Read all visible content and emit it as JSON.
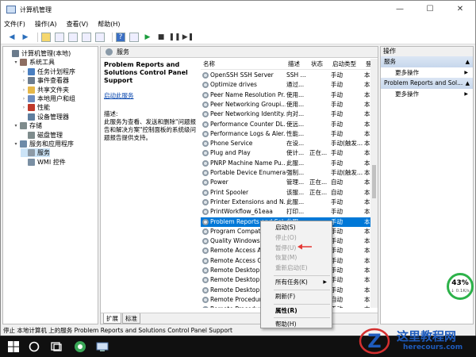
{
  "window": {
    "title": "计算机管理",
    "minimize": "—",
    "maximize": "☐",
    "close": "✕"
  },
  "menu": [
    "文件(F)",
    "操作(A)",
    "查看(V)",
    "帮助(H)"
  ],
  "tree": [
    {
      "label": "计算机管理(本地)",
      "level": 0,
      "exp": "",
      "color": "#6b7b8c"
    },
    {
      "label": "系统工具",
      "level": 1,
      "exp": "▾",
      "color": "#8d6e63"
    },
    {
      "label": "任务计划程序",
      "level": 2,
      "exp": "›",
      "color": "#4a7fc1"
    },
    {
      "label": "事件查看器",
      "level": 2,
      "exp": "›",
      "color": "#6d7d8f"
    },
    {
      "label": "共享文件夹",
      "level": 2,
      "exp": "›",
      "color": "#e6b84a"
    },
    {
      "label": "本地用户和组",
      "level": 2,
      "exp": "›",
      "color": "#6c8cc0"
    },
    {
      "label": "性能",
      "level": 2,
      "exp": "›",
      "color": "#c0392b"
    },
    {
      "label": "设备管理器",
      "level": 2,
      "exp": "",
      "color": "#5f7f9f"
    },
    {
      "label": "存储",
      "level": 1,
      "exp": "▾",
      "color": "#7f8c8d"
    },
    {
      "label": "磁盘管理",
      "level": 2,
      "exp": "",
      "color": "#7f8c8d"
    },
    {
      "label": "服务和应用程序",
      "level": 1,
      "exp": "▾",
      "color": "#6d8aa8"
    },
    {
      "label": "服务",
      "level": 2,
      "exp": "",
      "color": "#8d9aa6",
      "selected": true
    },
    {
      "label": "WMI 控件",
      "level": 2,
      "exp": "",
      "color": "#7a8fa3"
    }
  ],
  "services_header": "服务",
  "description": {
    "name": "Problem Reports and Solutions Control Panel Support",
    "link": "启动此服务",
    "label": "描述:",
    "text": "此服务为查看、发送和删除\"问题报告和解决方案\"控制面板的系统级问题报告提供支持。"
  },
  "columns": [
    "名称",
    "描述",
    "状态",
    "启动类型",
    "登"
  ],
  "rows": [
    [
      "OpenSSH SSH Server",
      "SSH ...",
      "",
      "手动",
      "本"
    ],
    [
      "Optimize drives",
      "通过...",
      "",
      "手动",
      "本"
    ],
    [
      "Peer Name Resolution Pr...",
      "使用...",
      "",
      "手动",
      "本"
    ],
    [
      "Peer Networking Groupi...",
      "使用...",
      "",
      "手动",
      "本"
    ],
    [
      "Peer Networking Identity...",
      "向对...",
      "",
      "手动",
      "本"
    ],
    [
      "Performance Counter DL...",
      "使远...",
      "",
      "手动",
      "本"
    ],
    [
      "Performance Logs & Aler...",
      "性能...",
      "",
      "手动",
      "本"
    ],
    [
      "Phone Service",
      "在设...",
      "",
      "手动(触发...",
      "本"
    ],
    [
      "Plug and Play",
      "使计...",
      "正在...",
      "手动",
      "本"
    ],
    [
      "PNRP Machine Name Pu...",
      "此服...",
      "",
      "手动",
      "本"
    ],
    [
      "Portable Device Enumera...",
      "强制...",
      "",
      "手动(触发...",
      "本"
    ],
    [
      "Power",
      "管理...",
      "正在...",
      "自动",
      "本"
    ],
    [
      "Print Spooler",
      "该服...",
      "正在...",
      "自动",
      "本"
    ],
    [
      "Printer Extensions and N...",
      "此服...",
      "",
      "手动",
      "本"
    ],
    [
      "PrintWorkflow_61eaa",
      "打印...",
      "",
      "手动",
      "本"
    ],
    [
      "Problem Reports and Sol...",
      "此服...",
      "",
      "手动",
      "本"
    ],
    [
      "Program Compati...",
      "",
      "",
      "手动",
      "本"
    ],
    [
      "Quality Windows A...",
      "",
      "",
      "手动",
      "本"
    ],
    [
      "Remote Access Au...",
      "",
      "",
      "手动",
      "本"
    ],
    [
      "Remote Access Co...",
      "",
      "",
      "手动",
      "本"
    ],
    [
      "Remote Desktop C...",
      "",
      "",
      "手动",
      "本"
    ],
    [
      "Remote Desktop S...",
      "",
      "",
      "手动",
      "本"
    ],
    [
      "Remote Desktop S...",
      "",
      "",
      "手动",
      "本"
    ],
    [
      "Remote Procedure...",
      "",
      "",
      "自动",
      "本"
    ],
    [
      "Remote Procedure...",
      "",
      "",
      "手动",
      "本"
    ]
  ],
  "selected_row": 15,
  "tabs": [
    "扩展",
    "标准"
  ],
  "actions": {
    "title": "操作",
    "sections": [
      {
        "label": "服务",
        "items": [
          "更多操作"
        ]
      },
      {
        "label": "Problem Reports and Sol...",
        "items": [
          "更多操作"
        ]
      }
    ]
  },
  "context_menu": [
    {
      "label": "启动(S)",
      "disabled": false
    },
    {
      "label": "停止(O)",
      "disabled": true
    },
    {
      "label": "暂停(U)",
      "disabled": true
    },
    {
      "label": "恢复(M)",
      "disabled": true
    },
    {
      "label": "重新启动(E)",
      "disabled": true
    },
    {
      "sep": true
    },
    {
      "label": "所有任务(K)",
      "disabled": false,
      "submenu": true
    },
    {
      "sep": true
    },
    {
      "label": "刷新(F)",
      "disabled": false
    },
    {
      "sep": true
    },
    {
      "label": "属性(R)",
      "disabled": false,
      "bold": true
    },
    {
      "sep": true
    },
    {
      "label": "帮助(H)",
      "disabled": false
    }
  ],
  "statusbar": "停止 本地计算机 上的服务 Problem Reports and Solutions Control Panel Support",
  "perf": {
    "percent": "43%",
    "speed": "↓ 0.1K/s"
  },
  "watermark": {
    "line1": "这里教程网",
    "line2": "herecours.com"
  },
  "colors": {
    "accent": "#0078d7",
    "perf_ring": "#2db24a",
    "watermark": "#1e5bbd"
  }
}
